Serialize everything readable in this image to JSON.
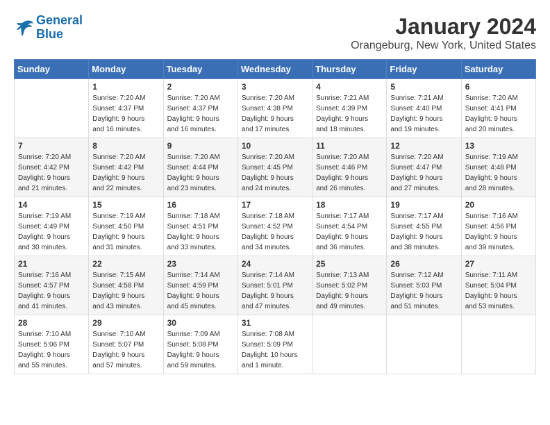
{
  "logo": {
    "line1": "General",
    "line2": "Blue"
  },
  "title": "January 2024",
  "location": "Orangeburg, New York, United States",
  "days_header": [
    "Sunday",
    "Monday",
    "Tuesday",
    "Wednesday",
    "Thursday",
    "Friday",
    "Saturday"
  ],
  "weeks": [
    [
      {
        "day": "",
        "info": ""
      },
      {
        "day": "1",
        "info": "Sunrise: 7:20 AM\nSunset: 4:37 PM\nDaylight: 9 hours\nand 16 minutes."
      },
      {
        "day": "2",
        "info": "Sunrise: 7:20 AM\nSunset: 4:37 PM\nDaylight: 9 hours\nand 16 minutes."
      },
      {
        "day": "3",
        "info": "Sunrise: 7:20 AM\nSunset: 4:38 PM\nDaylight: 9 hours\nand 17 minutes."
      },
      {
        "day": "4",
        "info": "Sunrise: 7:21 AM\nSunset: 4:39 PM\nDaylight: 9 hours\nand 18 minutes."
      },
      {
        "day": "5",
        "info": "Sunrise: 7:21 AM\nSunset: 4:40 PM\nDaylight: 9 hours\nand 19 minutes."
      },
      {
        "day": "6",
        "info": "Sunrise: 7:20 AM\nSunset: 4:41 PM\nDaylight: 9 hours\nand 20 minutes."
      }
    ],
    [
      {
        "day": "7",
        "info": ""
      },
      {
        "day": "8",
        "info": "Sunrise: 7:20 AM\nSunset: 4:42 PM\nDaylight: 9 hours\nand 22 minutes."
      },
      {
        "day": "9",
        "info": "Sunrise: 7:20 AM\nSunset: 4:44 PM\nDaylight: 9 hours\nand 23 minutes."
      },
      {
        "day": "10",
        "info": "Sunrise: 7:20 AM\nSunset: 4:45 PM\nDaylight: 9 hours\nand 24 minutes."
      },
      {
        "day": "11",
        "info": "Sunrise: 7:20 AM\nSunset: 4:46 PM\nDaylight: 9 hours\nand 26 minutes."
      },
      {
        "day": "12",
        "info": "Sunrise: 7:20 AM\nSunset: 4:47 PM\nDaylight: 9 hours\nand 27 minutes."
      },
      {
        "day": "13",
        "info": "Sunrise: 7:19 AM\nSunset: 4:48 PM\nDaylight: 9 hours\nand 28 minutes."
      }
    ],
    [
      {
        "day": "14",
        "info": ""
      },
      {
        "day": "15",
        "info": "Sunrise: 7:19 AM\nSunset: 4:50 PM\nDaylight: 9 hours\nand 31 minutes."
      },
      {
        "day": "16",
        "info": "Sunrise: 7:18 AM\nSunset: 4:51 PM\nDaylight: 9 hours\nand 33 minutes."
      },
      {
        "day": "17",
        "info": "Sunrise: 7:18 AM\nSunset: 4:52 PM\nDaylight: 9 hours\nand 34 minutes."
      },
      {
        "day": "18",
        "info": "Sunrise: 7:17 AM\nSunset: 4:54 PM\nDaylight: 9 hours\nand 36 minutes."
      },
      {
        "day": "19",
        "info": "Sunrise: 7:17 AM\nSunset: 4:55 PM\nDaylight: 9 hours\nand 38 minutes."
      },
      {
        "day": "20",
        "info": "Sunrise: 7:16 AM\nSunset: 4:56 PM\nDaylight: 9 hours\nand 39 minutes."
      }
    ],
    [
      {
        "day": "21",
        "info": ""
      },
      {
        "day": "22",
        "info": "Sunrise: 7:15 AM\nSunset: 4:58 PM\nDaylight: 9 hours\nand 43 minutes."
      },
      {
        "day": "23",
        "info": "Sunrise: 7:14 AM\nSunset: 4:59 PM\nDaylight: 9 hours\nand 45 minutes."
      },
      {
        "day": "24",
        "info": "Sunrise: 7:14 AM\nSunset: 5:01 PM\nDaylight: 9 hours\nand 47 minutes."
      },
      {
        "day": "25",
        "info": "Sunrise: 7:13 AM\nSunset: 5:02 PM\nDaylight: 9 hours\nand 49 minutes."
      },
      {
        "day": "26",
        "info": "Sunrise: 7:12 AM\nSunset: 5:03 PM\nDaylight: 9 hours\nand 51 minutes."
      },
      {
        "day": "27",
        "info": "Sunrise: 7:11 AM\nSunset: 5:04 PM\nDaylight: 9 hours\nand 53 minutes."
      }
    ],
    [
      {
        "day": "28",
        "info": "Sunrise: 7:10 AM\nSunset: 5:06 PM\nDaylight: 9 hours\nand 55 minutes."
      },
      {
        "day": "29",
        "info": "Sunrise: 7:10 AM\nSunset: 5:07 PM\nDaylight: 9 hours\nand 57 minutes."
      },
      {
        "day": "30",
        "info": "Sunrise: 7:09 AM\nSunset: 5:08 PM\nDaylight: 9 hours\nand 59 minutes."
      },
      {
        "day": "31",
        "info": "Sunrise: 7:08 AM\nSunset: 5:09 PM\nDaylight: 10 hours\nand 1 minute."
      },
      {
        "day": "",
        "info": ""
      },
      {
        "day": "",
        "info": ""
      },
      {
        "day": "",
        "info": ""
      }
    ]
  ],
  "week7_sun": "Sunrise: 7:20 AM\nSunset: 4:42 PM\nDaylight: 9 hours\nand 21 minutes.",
  "week14_sun": "Sunrise: 7:19 AM\nSunset: 4:49 PM\nDaylight: 9 hours\nand 30 minutes.",
  "week21_sun": "Sunrise: 7:16 AM\nSunset: 4:57 PM\nDaylight: 9 hours\nand 41 minutes."
}
